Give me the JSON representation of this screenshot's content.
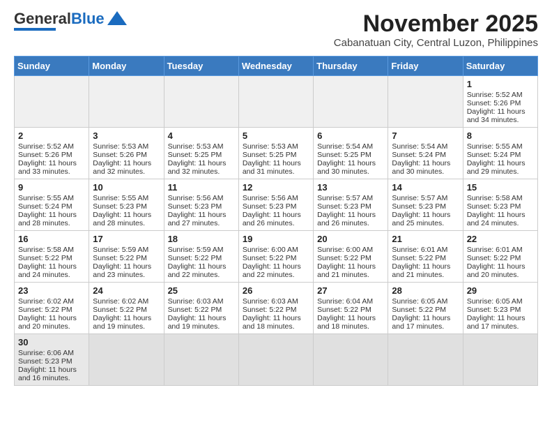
{
  "header": {
    "logo": {
      "general": "General",
      "blue": "Blue"
    },
    "title": "November 2025",
    "subtitle": "Cabanatuan City, Central Luzon, Philippines"
  },
  "days_of_week": [
    "Sunday",
    "Monday",
    "Tuesday",
    "Wednesday",
    "Thursday",
    "Friday",
    "Saturday"
  ],
  "weeks": [
    [
      {
        "day": "",
        "sunrise": "",
        "sunset": "",
        "daylight": "",
        "empty": true
      },
      {
        "day": "",
        "sunrise": "",
        "sunset": "",
        "daylight": "",
        "empty": true
      },
      {
        "day": "",
        "sunrise": "",
        "sunset": "",
        "daylight": "",
        "empty": true
      },
      {
        "day": "",
        "sunrise": "",
        "sunset": "",
        "daylight": "",
        "empty": true
      },
      {
        "day": "",
        "sunrise": "",
        "sunset": "",
        "daylight": "",
        "empty": true
      },
      {
        "day": "",
        "sunrise": "",
        "sunset": "",
        "daylight": "",
        "empty": true
      },
      {
        "day": "1",
        "sunrise": "Sunrise: 5:52 AM",
        "sunset": "Sunset: 5:26 PM",
        "daylight": "Daylight: 11 hours and 34 minutes.",
        "empty": false
      }
    ],
    [
      {
        "day": "2",
        "sunrise": "Sunrise: 5:52 AM",
        "sunset": "Sunset: 5:26 PM",
        "daylight": "Daylight: 11 hours and 33 minutes.",
        "empty": false
      },
      {
        "day": "3",
        "sunrise": "Sunrise: 5:53 AM",
        "sunset": "Sunset: 5:26 PM",
        "daylight": "Daylight: 11 hours and 32 minutes.",
        "empty": false
      },
      {
        "day": "4",
        "sunrise": "Sunrise: 5:53 AM",
        "sunset": "Sunset: 5:25 PM",
        "daylight": "Daylight: 11 hours and 32 minutes.",
        "empty": false
      },
      {
        "day": "5",
        "sunrise": "Sunrise: 5:53 AM",
        "sunset": "Sunset: 5:25 PM",
        "daylight": "Daylight: 11 hours and 31 minutes.",
        "empty": false
      },
      {
        "day": "6",
        "sunrise": "Sunrise: 5:54 AM",
        "sunset": "Sunset: 5:25 PM",
        "daylight": "Daylight: 11 hours and 30 minutes.",
        "empty": false
      },
      {
        "day": "7",
        "sunrise": "Sunrise: 5:54 AM",
        "sunset": "Sunset: 5:24 PM",
        "daylight": "Daylight: 11 hours and 30 minutes.",
        "empty": false
      },
      {
        "day": "8",
        "sunrise": "Sunrise: 5:55 AM",
        "sunset": "Sunset: 5:24 PM",
        "daylight": "Daylight: 11 hours and 29 minutes.",
        "empty": false
      }
    ],
    [
      {
        "day": "9",
        "sunrise": "Sunrise: 5:55 AM",
        "sunset": "Sunset: 5:24 PM",
        "daylight": "Daylight: 11 hours and 28 minutes.",
        "empty": false
      },
      {
        "day": "10",
        "sunrise": "Sunrise: 5:55 AM",
        "sunset": "Sunset: 5:23 PM",
        "daylight": "Daylight: 11 hours and 28 minutes.",
        "empty": false
      },
      {
        "day": "11",
        "sunrise": "Sunrise: 5:56 AM",
        "sunset": "Sunset: 5:23 PM",
        "daylight": "Daylight: 11 hours and 27 minutes.",
        "empty": false
      },
      {
        "day": "12",
        "sunrise": "Sunrise: 5:56 AM",
        "sunset": "Sunset: 5:23 PM",
        "daylight": "Daylight: 11 hours and 26 minutes.",
        "empty": false
      },
      {
        "day": "13",
        "sunrise": "Sunrise: 5:57 AM",
        "sunset": "Sunset: 5:23 PM",
        "daylight": "Daylight: 11 hours and 26 minutes.",
        "empty": false
      },
      {
        "day": "14",
        "sunrise": "Sunrise: 5:57 AM",
        "sunset": "Sunset: 5:23 PM",
        "daylight": "Daylight: 11 hours and 25 minutes.",
        "empty": false
      },
      {
        "day": "15",
        "sunrise": "Sunrise: 5:58 AM",
        "sunset": "Sunset: 5:23 PM",
        "daylight": "Daylight: 11 hours and 24 minutes.",
        "empty": false
      }
    ],
    [
      {
        "day": "16",
        "sunrise": "Sunrise: 5:58 AM",
        "sunset": "Sunset: 5:22 PM",
        "daylight": "Daylight: 11 hours and 24 minutes.",
        "empty": false
      },
      {
        "day": "17",
        "sunrise": "Sunrise: 5:59 AM",
        "sunset": "Sunset: 5:22 PM",
        "daylight": "Daylight: 11 hours and 23 minutes.",
        "empty": false
      },
      {
        "day": "18",
        "sunrise": "Sunrise: 5:59 AM",
        "sunset": "Sunset: 5:22 PM",
        "daylight": "Daylight: 11 hours and 22 minutes.",
        "empty": false
      },
      {
        "day": "19",
        "sunrise": "Sunrise: 6:00 AM",
        "sunset": "Sunset: 5:22 PM",
        "daylight": "Daylight: 11 hours and 22 minutes.",
        "empty": false
      },
      {
        "day": "20",
        "sunrise": "Sunrise: 6:00 AM",
        "sunset": "Sunset: 5:22 PM",
        "daylight": "Daylight: 11 hours and 21 minutes.",
        "empty": false
      },
      {
        "day": "21",
        "sunrise": "Sunrise: 6:01 AM",
        "sunset": "Sunset: 5:22 PM",
        "daylight": "Daylight: 11 hours and 21 minutes.",
        "empty": false
      },
      {
        "day": "22",
        "sunrise": "Sunrise: 6:01 AM",
        "sunset": "Sunset: 5:22 PM",
        "daylight": "Daylight: 11 hours and 20 minutes.",
        "empty": false
      }
    ],
    [
      {
        "day": "23",
        "sunrise": "Sunrise: 6:02 AM",
        "sunset": "Sunset: 5:22 PM",
        "daylight": "Daylight: 11 hours and 20 minutes.",
        "empty": false
      },
      {
        "day": "24",
        "sunrise": "Sunrise: 6:02 AM",
        "sunset": "Sunset: 5:22 PM",
        "daylight": "Daylight: 11 hours and 19 minutes.",
        "empty": false
      },
      {
        "day": "25",
        "sunrise": "Sunrise: 6:03 AM",
        "sunset": "Sunset: 5:22 PM",
        "daylight": "Daylight: 11 hours and 19 minutes.",
        "empty": false
      },
      {
        "day": "26",
        "sunrise": "Sunrise: 6:03 AM",
        "sunset": "Sunset: 5:22 PM",
        "daylight": "Daylight: 11 hours and 18 minutes.",
        "empty": false
      },
      {
        "day": "27",
        "sunrise": "Sunrise: 6:04 AM",
        "sunset": "Sunset: 5:22 PM",
        "daylight": "Daylight: 11 hours and 18 minutes.",
        "empty": false
      },
      {
        "day": "28",
        "sunrise": "Sunrise: 6:05 AM",
        "sunset": "Sunset: 5:22 PM",
        "daylight": "Daylight: 11 hours and 17 minutes.",
        "empty": false
      },
      {
        "day": "29",
        "sunrise": "Sunrise: 6:05 AM",
        "sunset": "Sunset: 5:23 PM",
        "daylight": "Daylight: 11 hours and 17 minutes.",
        "empty": false
      }
    ],
    [
      {
        "day": "30",
        "sunrise": "Sunrise: 6:06 AM",
        "sunset": "Sunset: 5:23 PM",
        "daylight": "Daylight: 11 hours and 16 minutes.",
        "empty": false
      },
      {
        "day": "",
        "sunrise": "",
        "sunset": "",
        "daylight": "",
        "empty": true
      },
      {
        "day": "",
        "sunrise": "",
        "sunset": "",
        "daylight": "",
        "empty": true
      },
      {
        "day": "",
        "sunrise": "",
        "sunset": "",
        "daylight": "",
        "empty": true
      },
      {
        "day": "",
        "sunrise": "",
        "sunset": "",
        "daylight": "",
        "empty": true
      },
      {
        "day": "",
        "sunrise": "",
        "sunset": "",
        "daylight": "",
        "empty": true
      },
      {
        "day": "",
        "sunrise": "",
        "sunset": "",
        "daylight": "",
        "empty": true
      }
    ]
  ]
}
